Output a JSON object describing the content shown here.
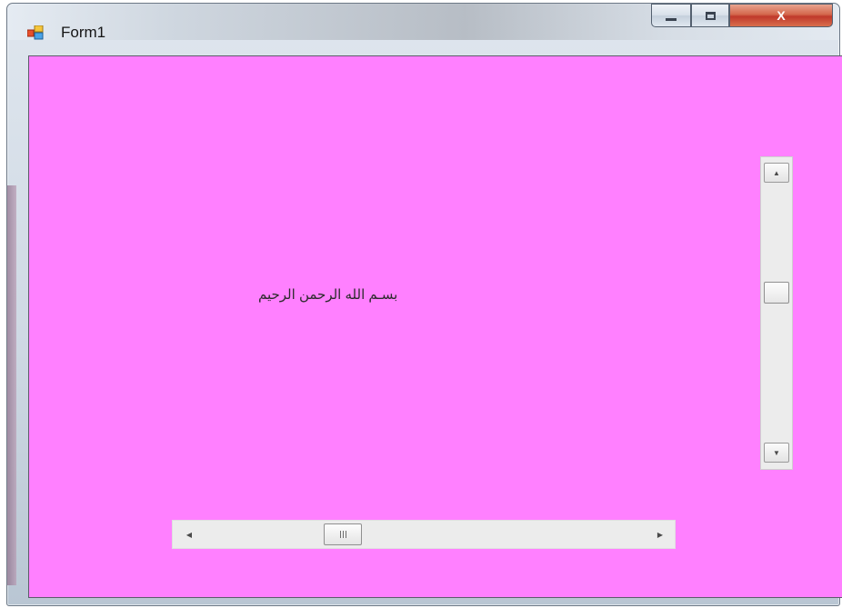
{
  "window": {
    "title": "Form1",
    "icon": "form-app-icon"
  },
  "title_bar_buttons": {
    "minimize_icon": "minimize-icon",
    "maximize_icon": "maximize-icon",
    "close_icon": "close-icon",
    "close_label": "X"
  },
  "client": {
    "background": "#ff80ff",
    "label_text": "بسـم الله الرحمن الرحيم"
  },
  "vertical_scrollbar": {
    "up_icon": "▲",
    "down_icon": "▼",
    "thumb_position_fraction": 0.46
  },
  "horizontal_scrollbar": {
    "left_icon": "◀",
    "right_icon": "▶",
    "thumb_position_fraction": 0.36
  },
  "colors": {
    "client_background": "#ff80ff",
    "close_button": "#c0392b"
  }
}
